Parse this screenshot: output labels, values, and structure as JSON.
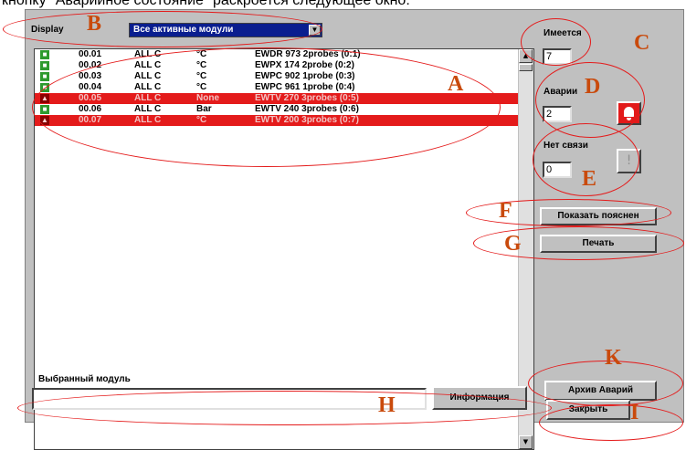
{
  "caption": "кнопку \"Аварийное состояние\" раскроется следующее окно:",
  "display": {
    "label": "Display",
    "selected": "Все активные модули"
  },
  "rows": [
    {
      "id": "00.01",
      "model": "ALL C",
      "unit": "°C",
      "desc": "EWDR 973 2probes (0:1)",
      "alarm": false
    },
    {
      "id": "00.02",
      "model": "ALL C",
      "unit": "°C",
      "desc": "EWPX 174 2probe (0:2)",
      "alarm": false
    },
    {
      "id": "00.03",
      "model": "ALL C",
      "unit": "°C",
      "desc": "EWPC 902 1probe (0:3)",
      "alarm": false
    },
    {
      "id": "00.04",
      "model": "ALL C",
      "unit": "°C",
      "desc": "EWPC 961 1probe (0:4)",
      "alarm": false
    },
    {
      "id": "00.05",
      "model": "ALL C",
      "unit": "None",
      "desc": "EWTV 270 3probes (0:5)",
      "alarm": true
    },
    {
      "id": "00.06",
      "model": "ALL C",
      "unit": "Bar",
      "desc": "EWTV 240 3probes (0:6)",
      "alarm": false
    },
    {
      "id": "00.07",
      "model": "ALL C",
      "unit": "°C",
      "desc": "EWTV 200 3probes (0:7)",
      "alarm": true
    }
  ],
  "side": {
    "available_label": "Имеется",
    "available_value": "7",
    "alarms_label": "Аварии",
    "alarms_value": "2",
    "nolink_label": "Нет связи",
    "nolink_value": "0"
  },
  "buttons": {
    "show_notes": "Показать пояснен",
    "print": "Печать",
    "alarm_archive": "Архив Аварий",
    "close": "Закрыть",
    "info": "Информация"
  },
  "selected_module": {
    "label": "Выбранный модуль",
    "value": ""
  },
  "annotations": [
    "A",
    "B",
    "C",
    "D",
    "E",
    "F",
    "G",
    "H",
    "I",
    "K"
  ],
  "colors": {
    "alarm_row": "#e41b1b",
    "ok_icon": "#2e9a2e",
    "annotation": "#e41b1b",
    "letters": "#c94a0c",
    "select_bg": "#0a1e8f"
  }
}
